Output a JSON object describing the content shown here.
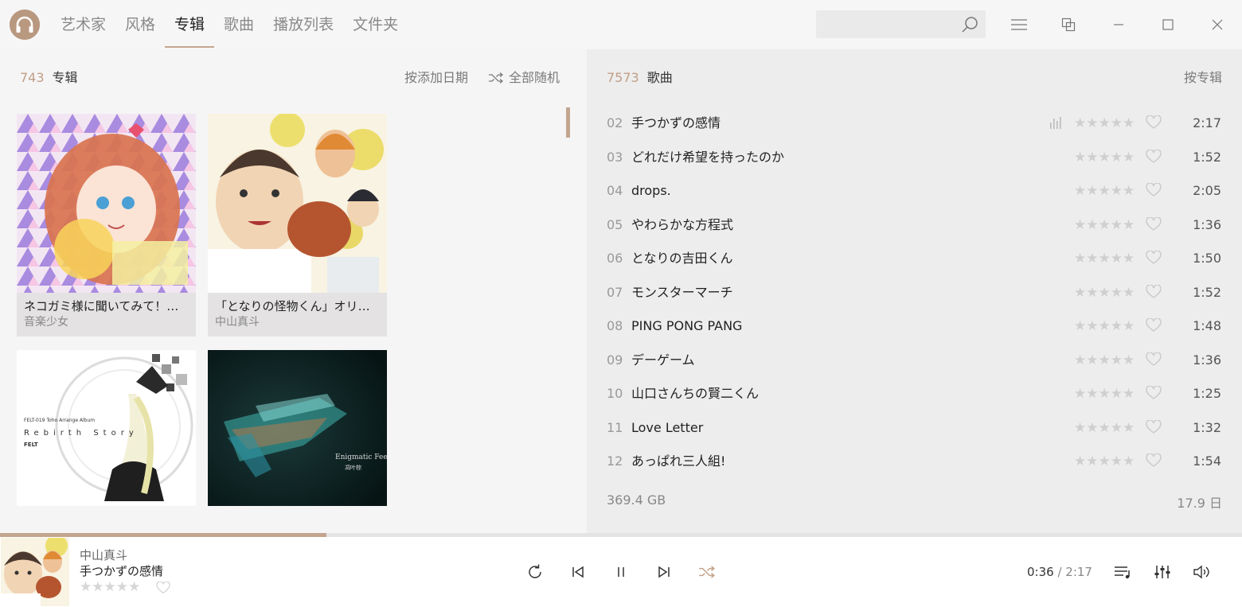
{
  "nav": {
    "tabs": [
      {
        "label": "艺术家"
      },
      {
        "label": "风格"
      },
      {
        "label": "专辑"
      },
      {
        "label": "歌曲"
      },
      {
        "label": "播放列表"
      },
      {
        "label": "文件夹"
      }
    ],
    "active_tab": "专辑",
    "search_placeholder": ""
  },
  "albums_pane": {
    "count": "743",
    "label": "专辑",
    "sort_label": "按添加日期",
    "shuffle_label": "全部随机",
    "albums": [
      {
        "title": "ネコガミ様に聞いてみて！＆…",
        "artist": "音楽少女"
      },
      {
        "title": "「となりの怪物くん」オリジ…",
        "artist": "中山真斗"
      },
      {
        "title": "",
        "artist": ""
      },
      {
        "title": "",
        "artist": ""
      }
    ]
  },
  "songs_pane": {
    "count": "7573",
    "label": "歌曲",
    "sort_label": "按专辑",
    "songs": [
      {
        "num": "02",
        "title": "手つかずの感情",
        "duration": "2:17",
        "playing": true
      },
      {
        "num": "03",
        "title": "どれだけ希望を持ったのか",
        "duration": "1:52"
      },
      {
        "num": "04",
        "title": "drops.",
        "duration": "2:05"
      },
      {
        "num": "05",
        "title": "やわらかな方程式",
        "duration": "1:36"
      },
      {
        "num": "06",
        "title": "となりの吉田くん",
        "duration": "1:50"
      },
      {
        "num": "07",
        "title": "モンスターマーチ",
        "duration": "1:52"
      },
      {
        "num": "08",
        "title": "PING PONG PANG",
        "duration": "1:48"
      },
      {
        "num": "09",
        "title": "デーゲーム",
        "duration": "1:36"
      },
      {
        "num": "10",
        "title": "山口さんちの賢二くん",
        "duration": "1:25"
      },
      {
        "num": "11",
        "title": "Love Letter",
        "duration": "1:32"
      },
      {
        "num": "12",
        "title": "あっぱれ三人組!",
        "duration": "1:54"
      }
    ],
    "total_size": "369.4 GB",
    "total_duration": "17.9 日"
  },
  "player": {
    "artist": "中山真斗",
    "title": "手つかずの感情",
    "stars": "★★★★★",
    "elapsed": "0:36",
    "separator": " / ",
    "total": "2:17",
    "progress": 0.263
  },
  "rating": {
    "stars": "★★★★★"
  },
  "colors": {
    "accent": "#c3a58f",
    "count_color": "#c09f86",
    "left_bg": "#f6f5f6",
    "right_bg": "#eeedee"
  },
  "cover_texts": {
    "rebirth_line1": "FELT-019 Toho Arrange Album",
    "rebirth_title": "Rebirth Story",
    "rebirth_label": "FELT",
    "enigmatic_title": "Enigmatic Feeling",
    "enigmatic_label": "凋叶棕"
  },
  "icons": {
    "logo": "headphones-logo-icon",
    "search": "search-icon",
    "menu": "hamburger-menu-icon",
    "mini_mode": "mini-mode-icon",
    "minimize": "minimize-icon",
    "maximize": "maximize-icon",
    "close": "close-icon",
    "shuffle": "shuffle-icon",
    "equalizer": "now-playing-bars-icon",
    "heart": "heart-icon",
    "repeat": "repeat-icon",
    "previous": "previous-icon",
    "pause": "pause-icon",
    "next": "next-icon",
    "playlist": "playlist-icon",
    "mixer": "mixer-icon",
    "volume": "volume-icon"
  }
}
